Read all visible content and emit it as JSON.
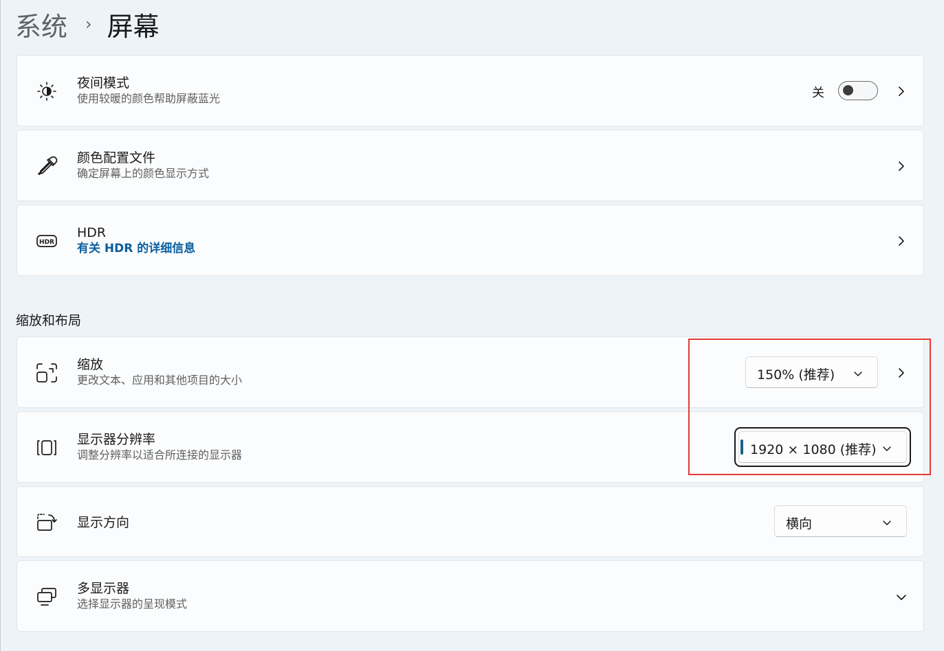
{
  "breadcrumb": {
    "parent": "系统",
    "separator": "›",
    "current": "屏幕"
  },
  "cards": {
    "night_light": {
      "title": "夜间模式",
      "subtitle": "使用较暖的颜色帮助屏蔽蓝光",
      "toggle_state_label": "关",
      "toggle_on": false,
      "icon": "brightness-icon"
    },
    "color_profile": {
      "title": "颜色配置文件",
      "subtitle": "确定屏幕上的颜色显示方式",
      "icon": "eyedropper-icon"
    },
    "hdr": {
      "title": "HDR",
      "link": "有关 HDR 的详细信息",
      "icon": "hdr-icon"
    }
  },
  "section": {
    "scale_layout_label": "缩放和布局"
  },
  "scale_layout": {
    "scale": {
      "title": "缩放",
      "subtitle": "更改文本、应用和其他项目的大小",
      "value": "150% (推荐)",
      "icon": "scale-icon"
    },
    "resolution": {
      "title": "显示器分辨率",
      "subtitle": "调整分辨率以适合所连接的显示器",
      "value": "1920 × 1080 (推荐)",
      "icon": "resolution-icon"
    },
    "orientation": {
      "title": "显示方向",
      "value": "横向",
      "icon": "rotate-display-icon"
    },
    "multiple_displays": {
      "title": "多显示器",
      "subtitle": "选择显示器的呈现模式",
      "icon": "multi-monitor-icon"
    }
  },
  "colors": {
    "highlight": "#e53935",
    "link": "#0a5fa0",
    "accent": "#1a5f85"
  }
}
